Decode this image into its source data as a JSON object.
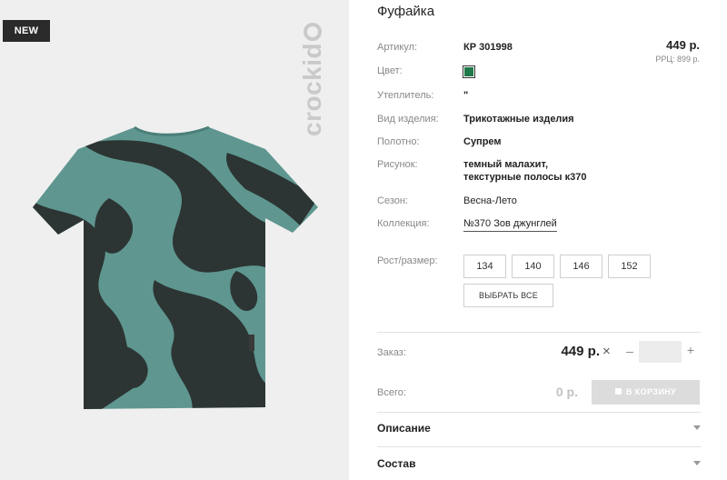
{
  "badge": "NEW",
  "brand": "crockid",
  "product": {
    "title": "Фуфайка",
    "price": "449 р.",
    "rrp": "РРЦ: 899 р."
  },
  "attributes": {
    "article": {
      "label": "Артикул:",
      "value": "КР 301998"
    },
    "color": {
      "label": "Цвет:",
      "swatch": "#1f7a4a"
    },
    "insulation": {
      "label": "Утеплитель:",
      "value": "\""
    },
    "item_type": {
      "label": "Вид изделия:",
      "value": "Трикотажные изделия"
    },
    "fabric": {
      "label": "Полотно:",
      "value": "Супрем"
    },
    "pattern": {
      "label": "Рисунок:",
      "line1": "темный малахит,",
      "line2": "текстурные полосы к370"
    },
    "season": {
      "label": "Сезон:",
      "value": "Весна-Лето"
    },
    "collection": {
      "label": "Коллекция:",
      "value": "№370 Зов джунглей"
    }
  },
  "sizes": {
    "label": "Рост/размер:",
    "options": [
      "134",
      "140",
      "146",
      "152"
    ],
    "select_all": "ВЫБРАТЬ ВСЕ"
  },
  "order": {
    "label": "Заказ:",
    "price": "449 р.",
    "times": "×",
    "minus": "–",
    "plus": "+",
    "quantity": ""
  },
  "total": {
    "label": "Всего:",
    "value": "0 р.",
    "cart_button": "В КОРЗИНУ"
  },
  "accordions": {
    "description": "Описание",
    "composition": "Состав"
  },
  "colors": {
    "shirt_base": "#5f9690",
    "shirt_pattern": "#2c3533",
    "badge_bg": "#2a2a2a",
    "swatch": "#1f7a4a"
  }
}
